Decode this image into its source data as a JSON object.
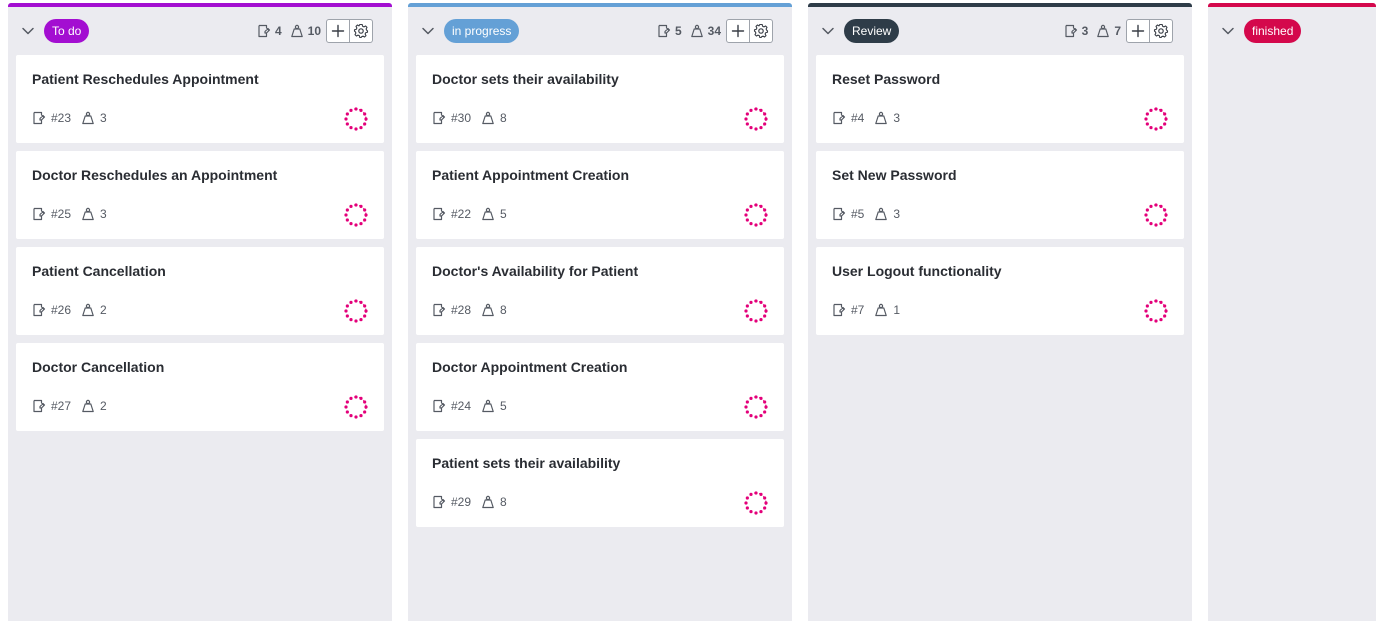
{
  "columns": [
    {
      "title": "To do",
      "color": "#a30ed1",
      "topbar_color": "#a30ed1",
      "item_count": "4",
      "points": "10",
      "cards": [
        {
          "title": "Patient Reschedules Appointment",
          "id": "#23",
          "points": "3"
        },
        {
          "title": "Doctor Reschedules an Appointment",
          "id": "#25",
          "points": "3"
        },
        {
          "title": "Patient Cancellation",
          "id": "#26",
          "points": "2"
        },
        {
          "title": "Doctor Cancellation",
          "id": "#27",
          "points": "2"
        }
      ]
    },
    {
      "title": "in progress",
      "color": "#64a0d6",
      "topbar_color": "#64a0d6",
      "item_count": "5",
      "points": "34",
      "cards": [
        {
          "title": "Doctor sets their availability",
          "id": "#30",
          "points": "8"
        },
        {
          "title": "Patient Appointment Creation",
          "id": "#22",
          "points": "5"
        },
        {
          "title": "Doctor's Availability for Patient",
          "id": "#28",
          "points": "8"
        },
        {
          "title": "Doctor Appointment Creation",
          "id": "#24",
          "points": "5"
        },
        {
          "title": "Patient sets their availability",
          "id": "#29",
          "points": "8"
        }
      ]
    },
    {
      "title": "Review",
      "color": "#2e3c48",
      "topbar_color": "#2e3c48",
      "item_count": "3",
      "points": "7",
      "cards": [
        {
          "title": "Reset Password",
          "id": "#4",
          "points": "3"
        },
        {
          "title": "Set New Password",
          "id": "#5",
          "points": "3"
        },
        {
          "title": "User Logout functionality",
          "id": "#7",
          "points": "1"
        }
      ]
    },
    {
      "title": "finished",
      "color": "#d4084c",
      "topbar_color": "#d4084c",
      "cards": []
    }
  ],
  "icons": {
    "collapse": "chevron-down-icon",
    "issue": "issue-note-icon",
    "points": "weight-icon",
    "add": "plus-icon",
    "settings": "gear-icon",
    "assignee": "avatar-placeholder-icon"
  },
  "avatar_color": "#e3007a"
}
